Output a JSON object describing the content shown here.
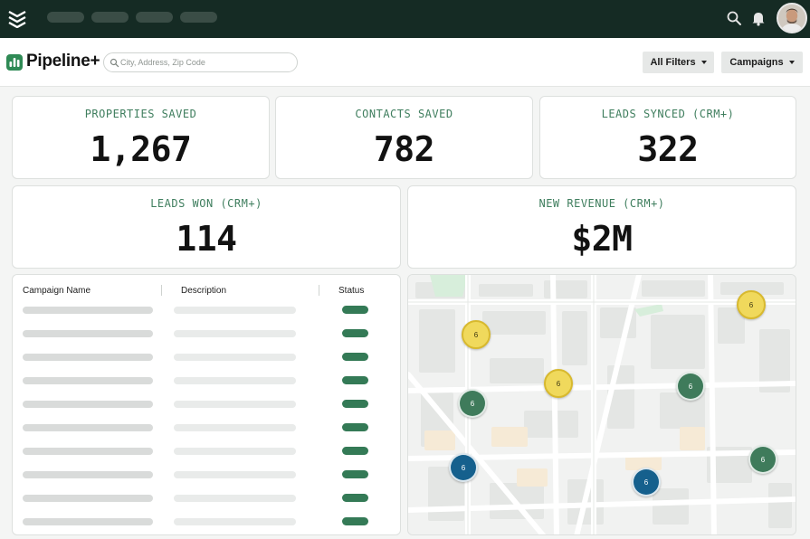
{
  "brand": {
    "name": "Pipeline+"
  },
  "search": {
    "placeholder": "City, Address, Zip Code"
  },
  "filters": {
    "all_filters_label": "All Filters",
    "campaigns_label": "Campaigns"
  },
  "stats": [
    {
      "label": "PROPERTIES SAVED",
      "value": "1,267"
    },
    {
      "label": "CONTACTS SAVED",
      "value": "782"
    },
    {
      "label": "LEADS SYNCED (CRM+)",
      "value": "322"
    },
    {
      "label": "LEADS WON (CRM+)",
      "value": "114"
    },
    {
      "label": "NEW REVENUE (CRM+)",
      "value": "$2M"
    }
  ],
  "table": {
    "headers": {
      "campaign": "Campaign Name",
      "description": "Description",
      "status": "Status"
    }
  },
  "map": {
    "pins": [
      {
        "label": "6",
        "color": "yellow"
      },
      {
        "label": "6",
        "color": "yellow"
      },
      {
        "label": "6",
        "color": "yellow"
      },
      {
        "label": "6",
        "color": "green"
      },
      {
        "label": "6",
        "color": "green"
      },
      {
        "label": "6",
        "color": "green"
      },
      {
        "label": "6",
        "color": "blue"
      },
      {
        "label": "6",
        "color": "blue"
      }
    ]
  },
  "colors": {
    "nav_bg": "#152b24",
    "accent_green": "#3f7e5e",
    "status_green": "#347a56",
    "pin_yellow": "#f0d95c",
    "pin_green": "#3f7b5b",
    "pin_blue": "#15608d"
  }
}
